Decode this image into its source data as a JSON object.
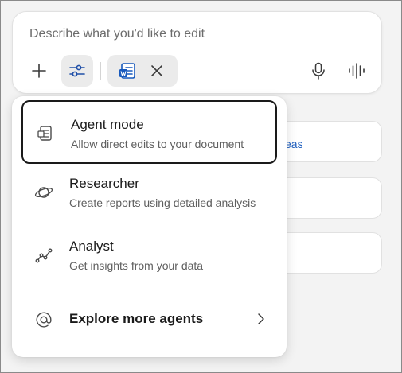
{
  "compose": {
    "placeholder": "Describe what you'd like to edit",
    "icons": [
      "plus-icon",
      "sliders-icon",
      "word-document-icon",
      "close-icon",
      "microphone-icon",
      "voice-waveform-icon"
    ]
  },
  "background_cards": [
    {
      "text": "eas"
    },
    {
      "text": ""
    },
    {
      "text": ""
    }
  ],
  "menu": {
    "items": [
      {
        "title": "Agent mode",
        "description": "Allow direct edits to your document",
        "icon": "document-agent-icon",
        "selected": true
      },
      {
        "title": "Researcher",
        "description": "Create reports using detailed analysis",
        "icon": "planet-icon",
        "selected": false
      },
      {
        "title": "Analyst",
        "description": "Get insights from your data",
        "icon": "line-chart-icon",
        "selected": false
      },
      {
        "title": "Explore more agents",
        "description": "",
        "icon": "at-sign-icon",
        "selected": false
      }
    ]
  },
  "colors": {
    "background": "#f3f3f3",
    "surface": "#ffffff",
    "selected_border": "#1a1a1a",
    "link_blue": "#1f5fbf",
    "word_blue": "#185abd"
  }
}
